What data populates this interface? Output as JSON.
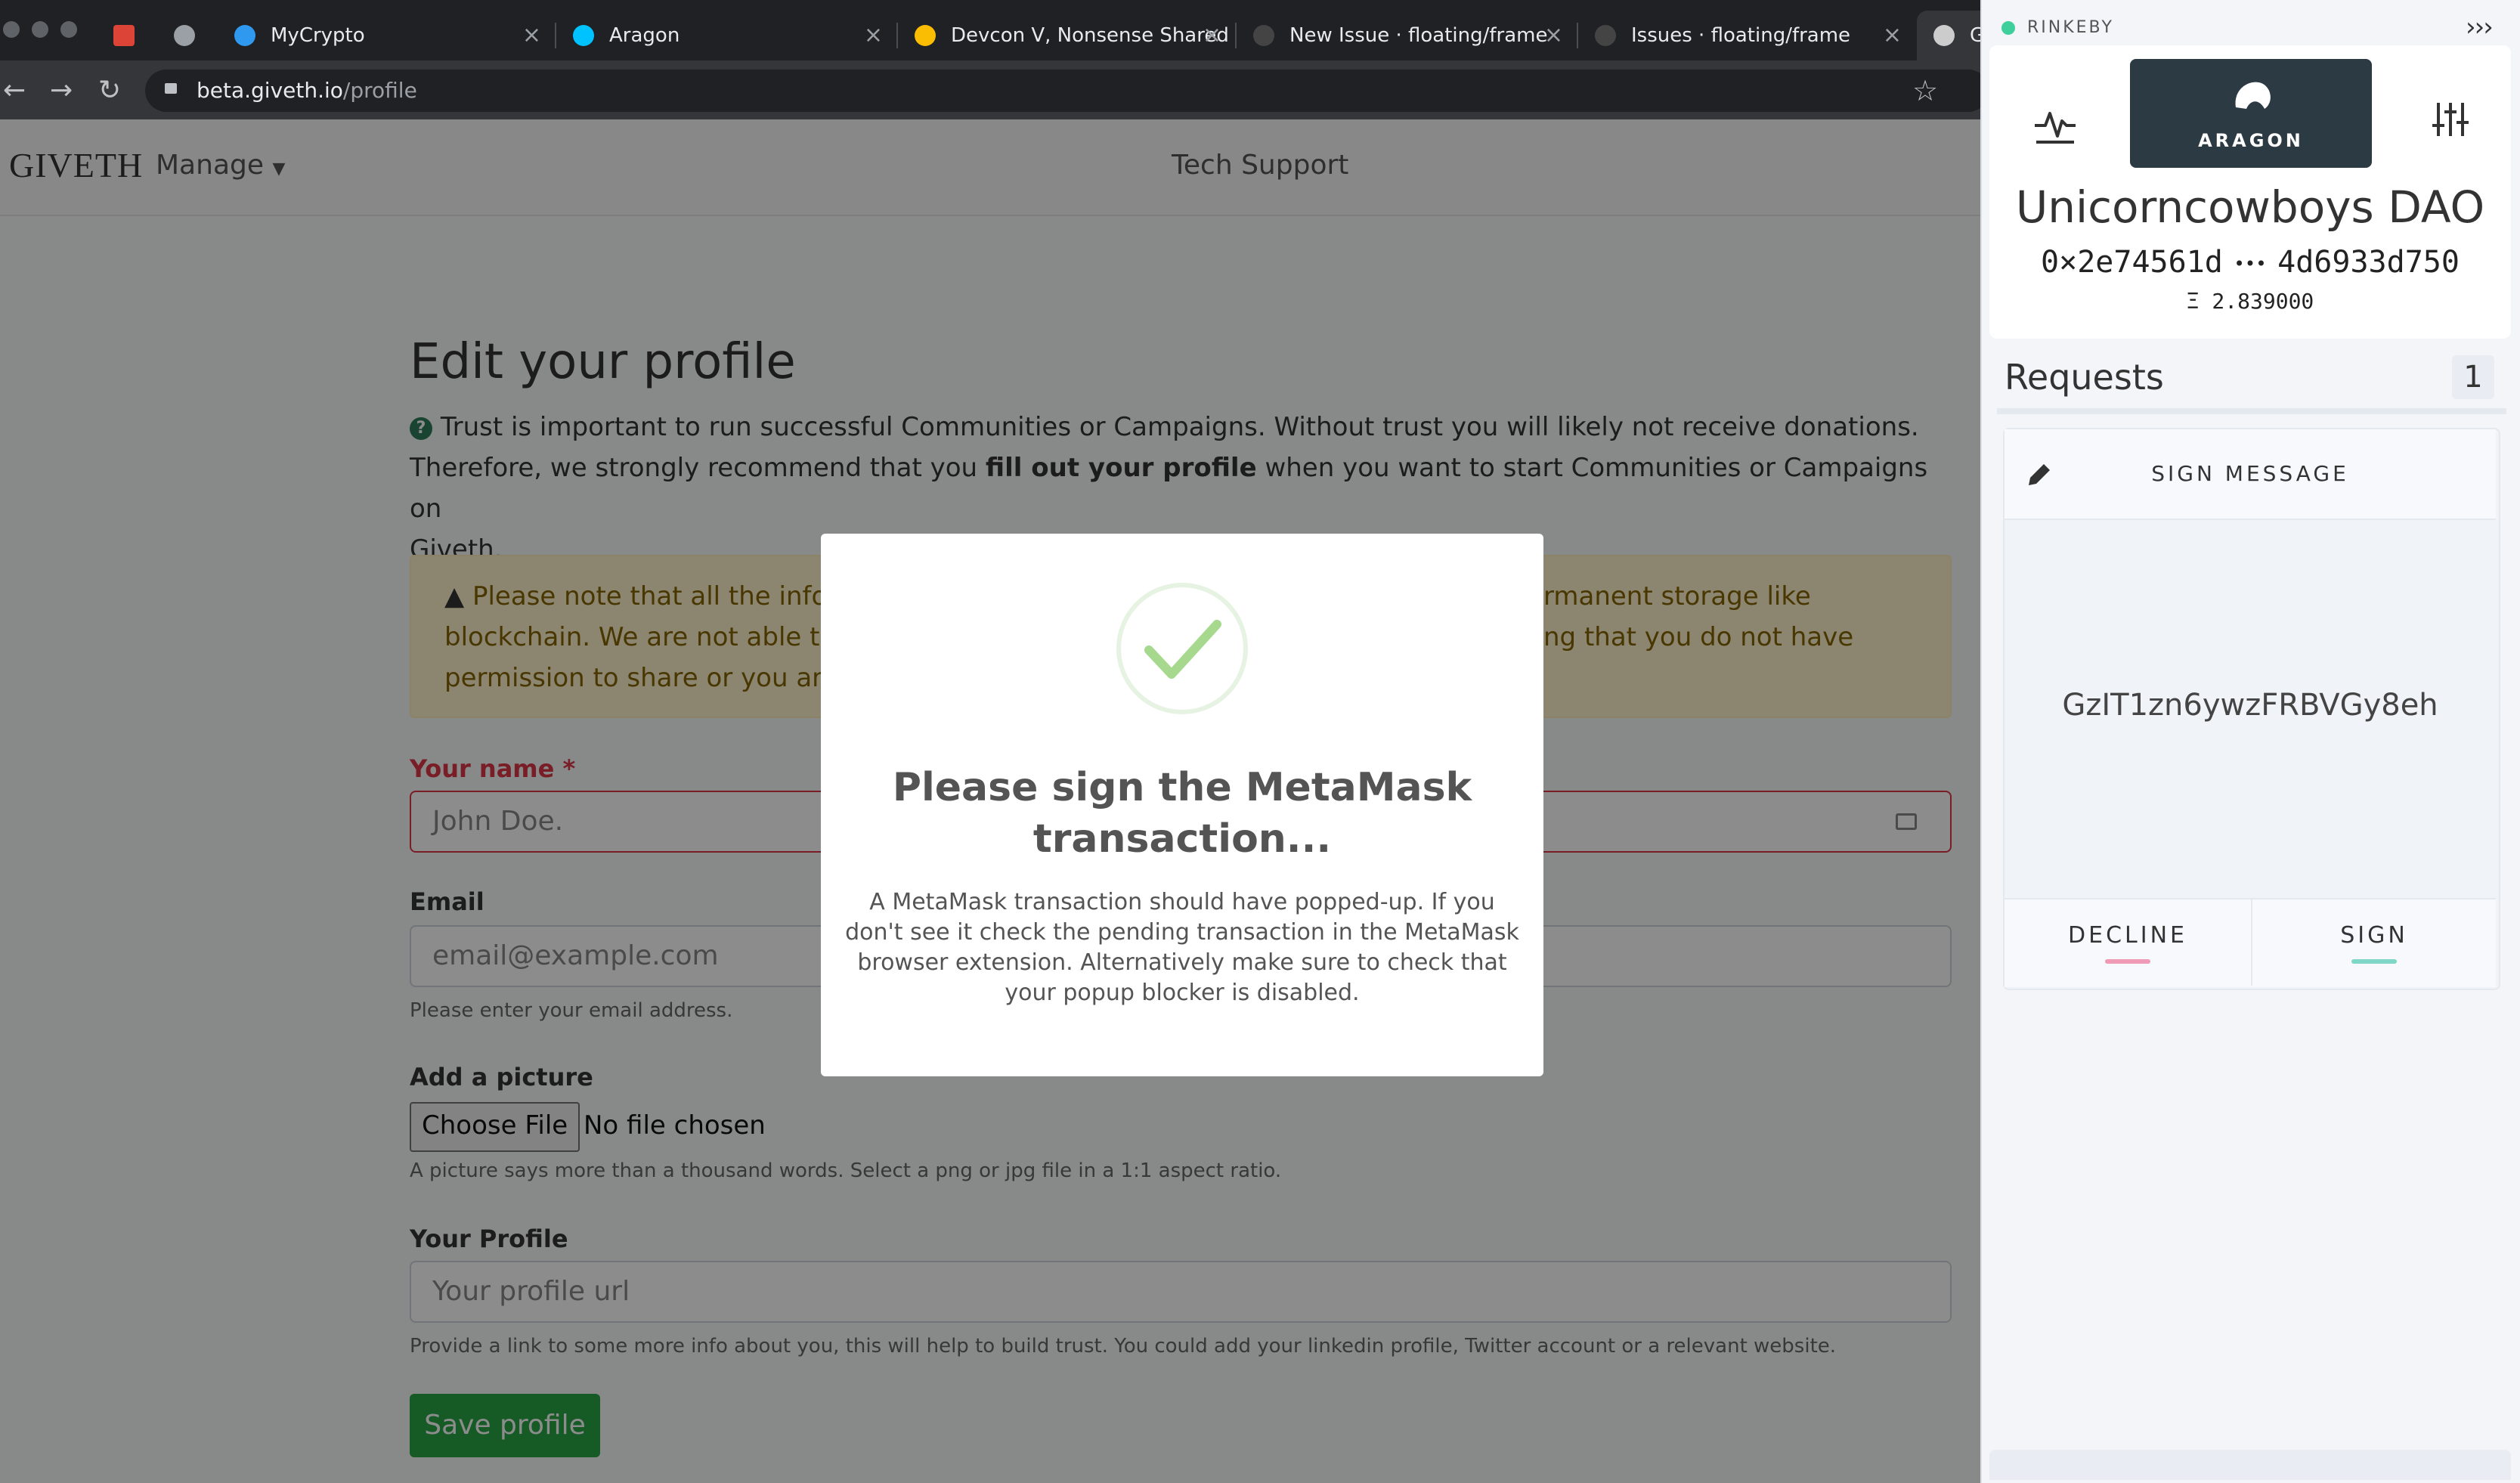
{
  "browser": {
    "tabs": [
      {
        "title": "",
        "icon": "gmail-icon",
        "color": "#db4437"
      },
      {
        "title": "",
        "icon": "mail-icon",
        "color": "#9aa0a6"
      },
      {
        "title": "MyCrypto",
        "icon": "mycrypto-icon",
        "color": "#2f99f0"
      },
      {
        "title": "Aragon",
        "icon": "aragon-icon",
        "color": "#00c2ff"
      },
      {
        "title": "Devcon V, Nonsense Shared",
        "icon": "photos-icon",
        "color": "#fbbc04"
      },
      {
        "title": "New Issue · floating/frame",
        "icon": "github-icon",
        "color": "#444"
      },
      {
        "title": "Issues · floating/frame",
        "icon": "github-icon",
        "color": "#444"
      },
      {
        "title": "G",
        "icon": "giveth-icon",
        "color": "#ccc"
      }
    ],
    "url_host": "beta.giveth.io",
    "url_path": "/profile"
  },
  "site": {
    "logo": "GIVETH",
    "manage_label": "Manage",
    "tech_support": "Tech Support"
  },
  "profile": {
    "title": "Edit your profile",
    "intro_1": "Trust is important to run successful Communities or Campaigns. Without trust you will likely not receive donations.",
    "intro_2a": "Therefore, we strongly recommend that you ",
    "intro_2b": "fill out your profile",
    "intro_2c": " when you want to start Communities or Campaigns on",
    "intro_3": "Giveth.",
    "warning_1a": "Please note that all the info",
    "warning_1b": "rmanent storage like",
    "warning_2a": "blockchain. We are not able to",
    "warning_2b": "ng that you do not have",
    "warning_3": "permission to share or you are",
    "name_label": "Your name",
    "name_required": "*",
    "name_placeholder": "John Doe.",
    "email_label": "Email",
    "email_placeholder": "email@example.com",
    "email_help": "Please enter your email address.",
    "picture_label": "Add a picture",
    "choose_file": "Choose File",
    "no_file": "No file chosen",
    "picture_help": "A picture says more than a thousand words. Select a png or jpg file in a 1:1 aspect ratio.",
    "profile_label": "Your Profile",
    "profile_placeholder": "Your profile url",
    "profile_help": "Provide a link to some more info about you, this will help to build trust. You could add your linkedin profile, Twitter account or a relevant website.",
    "save_button": "Save profile"
  },
  "modal": {
    "title_1": "Please sign the MetaMask",
    "title_2": "transaction...",
    "body_1": "A MetaMask transaction should have popped-up. If you",
    "body_2": "don't see it check the pending transaction in the MetaMask",
    "body_3": "browser extension. Alternatively make sure to check that",
    "body_4": "your popup blocker is disabled."
  },
  "frame": {
    "network": "RINKEBY",
    "collapse": "›››",
    "aragon_label": "ARAGON",
    "account_name": "Unicorncowboys DAO",
    "address_start": "0×2e74561d",
    "address_end": "4d6933d750",
    "balance": "Ξ 2.839000",
    "requests_label": "Requests",
    "requests_count": "1",
    "request_type": "SIGN MESSAGE",
    "message": "GzIT1zn6ywzFRBVGy8eh",
    "decline": "DECLINE",
    "sign": "SIGN",
    "colors": {
      "network_dot": "#3fcf9c",
      "decline": "#f09bb6",
      "sign": "#7fd8c7",
      "dark": "#2c3a44"
    }
  }
}
